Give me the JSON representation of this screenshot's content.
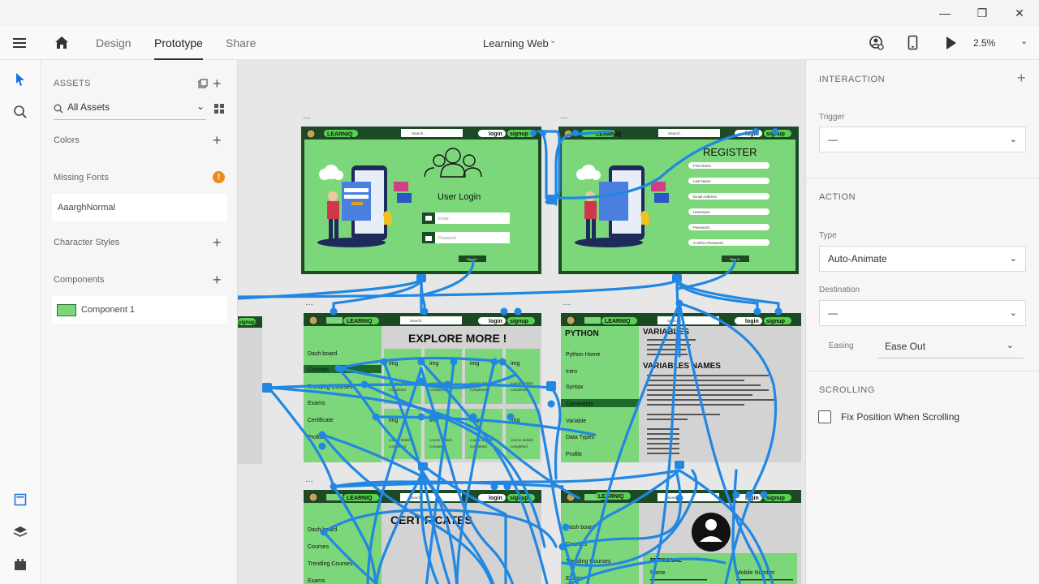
{
  "titlebar": {
    "controls": [
      "—",
      "❐",
      "✕"
    ]
  },
  "menubar": {
    "tabs": [
      {
        "label": "Design",
        "active": false
      },
      {
        "label": "Prototype",
        "active": true
      },
      {
        "label": "Share",
        "active": false
      }
    ],
    "document_title": "Learning Web",
    "zoom": "2.5%"
  },
  "assets_panel": {
    "header": "ASSETS",
    "search_value": "All Assets",
    "sections": {
      "colors": "Colors",
      "missing_fonts": "Missing Fonts",
      "missing_font_name": "AaarghNormal",
      "character_styles": "Character Styles",
      "components": "Components",
      "component_name": "Component 1"
    }
  },
  "canvas": {
    "artboards": {
      "login": {
        "logo": "LEARNIQ",
        "search": "Search...",
        "login": "login",
        "signup": "signup",
        "title": "User Login",
        "email": "Email",
        "password": "Password",
        "button": "Sign In"
      },
      "register": {
        "logo": "LEARNIQ",
        "search": "Search...",
        "login": "login",
        "signup": "signup",
        "title": "REGISTER",
        "fields": [
          "First Name",
          "Last Name",
          "Email Address",
          "Username",
          "Password",
          "Confirm Password"
        ],
        "button": "Sign In"
      },
      "explore": {
        "logo": "LEARNIQ",
        "search": "Search",
        "login": "login",
        "signup": "signup",
        "title": "EXPLORE MORE !",
        "nav": [
          "Dash board",
          "Courses",
          "Trending Courses",
          "Exams",
          "Certificate",
          "Profiles"
        ],
        "card_img": "img",
        "card_details": "course details",
        "card_status": "completed"
      },
      "python": {
        "logo": "LEARNIQ",
        "search": "Search",
        "login": "login",
        "signup": "signup",
        "nav_title": "PYTHON",
        "nav": [
          "Python Home",
          "Intro",
          "Syntax",
          "Comments",
          "Variable",
          "Data Types",
          "Profile"
        ],
        "heading1": "VARIABLES",
        "heading2": "VARIABLES NAMES"
      },
      "certificates": {
        "logo": "LEARNIQ",
        "search": "Search",
        "login": "login",
        "signup": "signup",
        "title": "CERTIFICATES",
        "nav": [
          "Dash board",
          "Courses",
          "Trending Courses",
          "Exams"
        ]
      },
      "profile": {
        "logo": "LEARNIQ",
        "search": "Search",
        "login": "login",
        "signup": "signup",
        "nav": [
          "Dash board",
          "Courses",
          "Trending Courses",
          "Exams"
        ],
        "section": "PERSONAL",
        "name_label": "Name",
        "mobile_label": "Mobile Number"
      },
      "partial": {
        "signup": "signup"
      }
    }
  },
  "inspector": {
    "interaction_header": "INTERACTION",
    "trigger_label": "Trigger",
    "trigger_value": "—",
    "action_header": "ACTION",
    "type_label": "Type",
    "type_value": "Auto-Animate",
    "destination_label": "Destination",
    "destination_value": "—",
    "easing_label": "Easing",
    "easing_value": "Ease Out",
    "scrolling_header": "SCROLLING",
    "fix_position_label": "Fix Position When Scrolling",
    "fix_position_checked": false
  },
  "colors": {
    "accent": "#2187e2",
    "artboard_green": "#7cd67a",
    "artboard_dark": "#1c4a25",
    "warning": "#f28a1b"
  }
}
